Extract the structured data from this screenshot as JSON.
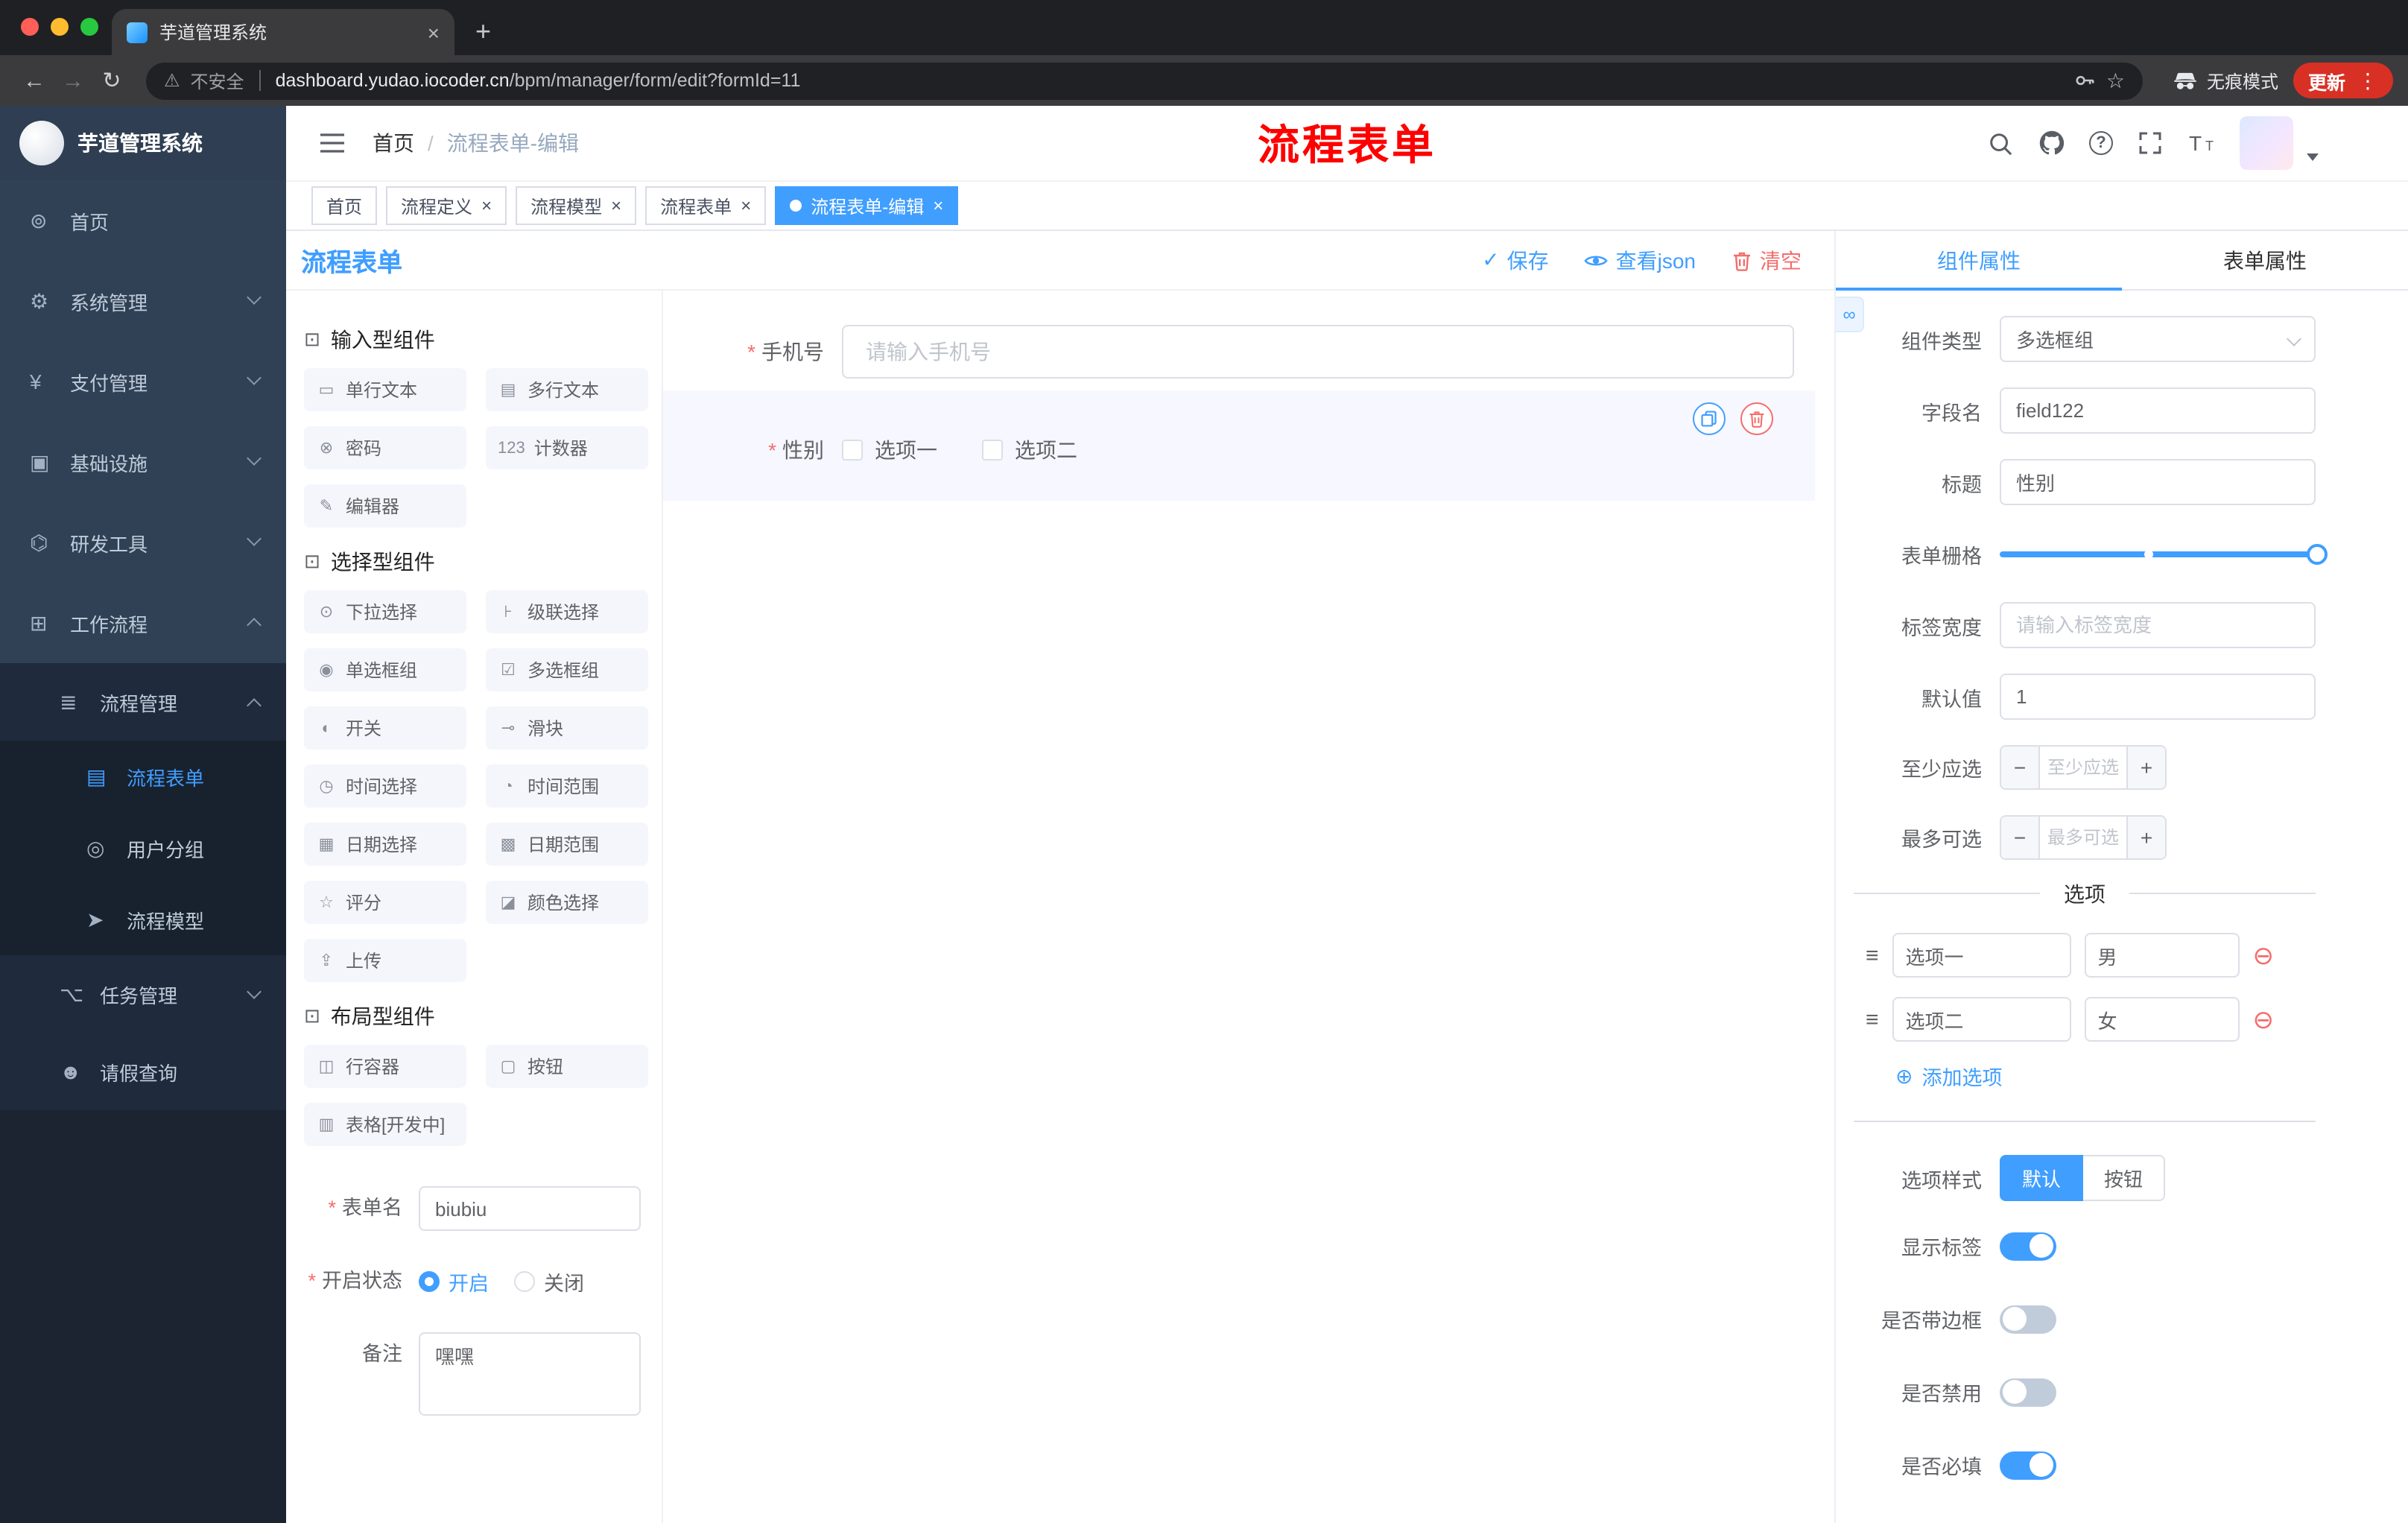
{
  "browser": {
    "tab_title": "芋道管理系统",
    "security_label": "不安全",
    "url_domain": "dashboard.yudao.iocoder.cn",
    "url_path": "/bpm/manager/form/edit?formId=11",
    "incognito_label": "无痕模式",
    "update_label": "更新"
  },
  "sidebar": {
    "title": "芋道管理系统",
    "items": [
      {
        "icon": "⊚",
        "label": "首页"
      },
      {
        "icon": "⚙",
        "label": "系统管理"
      },
      {
        "icon": "¥",
        "label": "支付管理"
      },
      {
        "icon": "▣",
        "label": "基础设施"
      },
      {
        "icon": "⌬",
        "label": "研发工具"
      },
      {
        "icon": "⊞",
        "label": "工作流程"
      },
      {
        "icon": "≣",
        "label": "流程管理"
      },
      {
        "icon": "▤",
        "label": "流程表单"
      },
      {
        "icon": "◎",
        "label": "用户分组"
      },
      {
        "icon": "➤",
        "label": "流程模型"
      },
      {
        "icon": "⌥",
        "label": "任务管理"
      },
      {
        "icon": "☻",
        "label": "请假查询"
      }
    ]
  },
  "header": {
    "breadcrumb_home": "首页",
    "breadcrumb_separator": "/",
    "breadcrumb_current": "流程表单-编辑",
    "watermark": "流程表单"
  },
  "tags": [
    {
      "label": "首页"
    },
    {
      "label": "流程定义"
    },
    {
      "label": "流程模型"
    },
    {
      "label": "流程表单"
    },
    {
      "label": "流程表单-编辑"
    }
  ],
  "builder": {
    "title": "流程表单",
    "save_label": "保存",
    "view_json_label": "查看json",
    "clear_label": "清空",
    "groups": [
      {
        "title": "输入型组件",
        "items": [
          {
            "icon": "▭",
            "label": "单行文本"
          },
          {
            "icon": "▤",
            "label": "多行文本"
          },
          {
            "icon": "⊗",
            "label": "密码"
          },
          {
            "icon": "123",
            "label": "计数器"
          },
          {
            "icon": "✎",
            "label": "编辑器"
          }
        ]
      },
      {
        "title": "选择型组件",
        "items": [
          {
            "icon": "⊙",
            "label": "下拉选择"
          },
          {
            "icon": "⊦",
            "label": "级联选择"
          },
          {
            "icon": "◉",
            "label": "单选框组"
          },
          {
            "icon": "☑",
            "label": "多选框组"
          },
          {
            "icon": "◐",
            "label": "开关"
          },
          {
            "icon": "⊸",
            "label": "滑块"
          },
          {
            "icon": "◷",
            "label": "时间选择"
          },
          {
            "icon": "◔",
            "label": "时间范围"
          },
          {
            "icon": "▦",
            "label": "日期选择"
          },
          {
            "icon": "▩",
            "label": "日期范围"
          },
          {
            "icon": "☆",
            "label": "评分"
          },
          {
            "icon": "◪",
            "label": "颜色选择"
          },
          {
            "icon": "⇪",
            "label": "上传"
          }
        ]
      },
      {
        "title": "布局型组件",
        "items": [
          {
            "icon": "◫",
            "label": "行容器"
          },
          {
            "icon": "▢",
            "label": "按钮"
          },
          {
            "icon": "▥",
            "label": "表格[开发中]"
          }
        ]
      }
    ],
    "meta": {
      "name_label": "表单名",
      "name_value": "biubiu",
      "status_label": "开启状态",
      "status_on": "开启",
      "status_off": "关闭",
      "remark_label": "备注",
      "remark_value": "嘿嘿"
    }
  },
  "canvas": {
    "phone_label": "手机号",
    "phone_placeholder": "请输入手机号",
    "gender_label": "性别",
    "gender_options": [
      "选项一",
      "选项二"
    ]
  },
  "inspector": {
    "tab_component": "组件属性",
    "tab_form": "表单属性",
    "rows": {
      "type_label": "组件类型",
      "type_value": "多选框组",
      "field_label": "字段名",
      "field_value": "field122",
      "title_label": "标题",
      "title_value": "性别",
      "grid_label": "表单栅格",
      "width_label": "标签宽度",
      "width_placeholder": "请输入标签宽度",
      "default_label": "默认值",
      "default_value": "1",
      "min_label": "至少应选",
      "min_placeholder": "至少应选",
      "max_label": "最多可选",
      "max_placeholder": "最多可选"
    },
    "options": {
      "divider_title": "选项",
      "rows": [
        {
          "label": "选项一",
          "value": "男"
        },
        {
          "label": "选项二",
          "value": "女"
        }
      ],
      "add_label": "添加选项"
    },
    "style": {
      "style_label": "选项样式",
      "style_default": "默认",
      "style_button": "按钮",
      "toggles": [
        {
          "label": "显示标签"
        },
        {
          "label": "是否带边框"
        },
        {
          "label": "是否禁用"
        },
        {
          "label": "是否必填"
        }
      ]
    }
  },
  "colors": {
    "accent": "#409eff",
    "danger": "#f56c6c",
    "watermark_red": "#ff0000"
  }
}
